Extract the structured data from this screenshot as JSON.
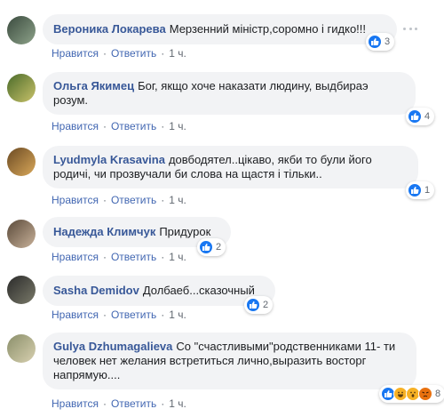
{
  "actions": {
    "like": "Нравится",
    "reply": "Ответить",
    "sep": "·"
  },
  "comments": [
    {
      "author": "Вероника Локарева",
      "text": "Мерзенний міністр,соромно і гидко!!!",
      "time": "1 ч.",
      "reaction_count": "3",
      "reactions": [
        "like-icon"
      ],
      "avatar_colors": [
        "#3a4a3e",
        "#8ea38a"
      ]
    },
    {
      "author": "Ольга Якимец",
      "text": "Бог, якщо хоче наказати людину, выдбираэ розум.",
      "time": "1 ч.",
      "reaction_count": "4",
      "reactions": [
        "like-icon"
      ],
      "avatar_colors": [
        "#4a6b2a",
        "#c9c26a"
      ]
    },
    {
      "author": "Lyudmyla Krasavina",
      "text": "довбодятел..цікаво, якби то були його родичі, чи прозвучали би слова на щастя і тільки..",
      "time": "1 ч.",
      "reaction_count": "1",
      "reactions": [
        "like-icon"
      ],
      "avatar_colors": [
        "#6b4a23",
        "#d9a85a"
      ]
    },
    {
      "author": "Надежда Климчук",
      "text": "Придурок",
      "time": "1 ч.",
      "reaction_count": "2",
      "reactions": [
        "like-icon"
      ],
      "avatar_colors": [
        "#5a4a3a",
        "#c9b29a"
      ]
    },
    {
      "author": "Sasha Demidov",
      "text": "Долбаеб...сказочный",
      "time": "1 ч.",
      "reaction_count": "2",
      "reactions": [
        "like-icon"
      ],
      "avatar_colors": [
        "#2a2a2a",
        "#7a7a6a"
      ]
    },
    {
      "author": "Gulya Dzhumagalieva",
      "text": "Со \"счастливыми\"родственниками 11- ти человек нет желания встретиться лично,выразить восторг напрямую....",
      "time": "1 ч.",
      "reaction_count": "8",
      "reactions": [
        "like-icon",
        "haha-icon",
        "wow-icon",
        "angry-icon"
      ],
      "avatar_colors": [
        "#8a8f6a",
        "#d8d0b0"
      ]
    }
  ]
}
